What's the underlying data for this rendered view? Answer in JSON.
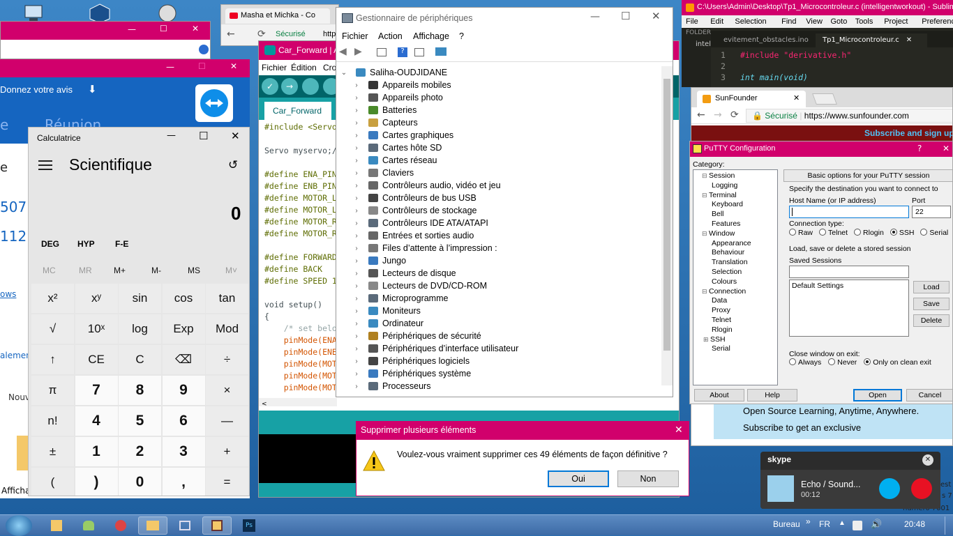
{
  "desktop": {
    "icons": [
      "computer-icon",
      "virtualbox-icon",
      "app-icon"
    ]
  },
  "back_window1": {
    "controls": [
      "—",
      "☐",
      "✕"
    ]
  },
  "back_window2": {
    "controls": [
      "—",
      "☐",
      "✕"
    ],
    "avis": "Donnez votre avis",
    "reunion": "Réunion",
    "n1": "507",
    "n2": "112",
    "link": "ows",
    "lem": "alement",
    "nouv": "Nouv",
    "affich": "Affichag",
    "e": "e"
  },
  "chrome_back": {
    "tab_title": "Masha et Michka - Co",
    "secure": "Sécurisé",
    "url_stub": "http"
  },
  "arduino": {
    "title": "Car_Forward | A",
    "menu": [
      "Fichier",
      "Édition",
      "Cro"
    ],
    "tab": "Car_Forward",
    "lines": [
      {
        "a": "#include <Servo"
      },
      {
        "a": ""
      },
      {
        "a": "Servo myservo;/"
      },
      {
        "a": ""
      },
      {
        "a": "#define ENA_PIN"
      },
      {
        "a": "#define ENB_PIN"
      },
      {
        "a": "#define MOTOR_L"
      },
      {
        "a": "#define MOTOR_L"
      },
      {
        "a": "#define MOTOR_R"
      },
      {
        "a": "#define MOTOR_R"
      },
      {
        "a": ""
      },
      {
        "a": "#define FORWARD"
      },
      {
        "a": "#define BACK"
      },
      {
        "a": "#define SPEED 1"
      },
      {
        "a": ""
      },
      {
        "a": "void setup()"
      },
      {
        "a": "{"
      },
      {
        "a": "    /* set belo"
      },
      {
        "a": "    pinMode(ENA"
      },
      {
        "a": "    pinMode(ENE"
      },
      {
        "a": "    pinMode(MOT"
      },
      {
        "a": "    pinMode(MOT"
      },
      {
        "a": "    pinMode(MOT"
      }
    ]
  },
  "calculator": {
    "title": "Calculatrice",
    "mode": "Scientifique",
    "display": "0",
    "angle": [
      "DEG",
      "HYP",
      "F-E"
    ],
    "memory": [
      "MC",
      "MR",
      "M+",
      "M-",
      "MS",
      "M˅"
    ],
    "keys": [
      [
        "x²",
        "xʸ",
        "sin",
        "cos",
        "tan"
      ],
      [
        "√",
        "10ˣ",
        "log",
        "Exp",
        "Mod"
      ],
      [
        "↑",
        "CE",
        "C",
        "⌫",
        "÷"
      ],
      [
        "π",
        "7",
        "8",
        "9",
        "×"
      ],
      [
        "n!",
        "4",
        "5",
        "6",
        "—"
      ],
      [
        "±",
        "1",
        "2",
        "3",
        "+"
      ],
      [
        "(",
        ")",
        "0",
        ",",
        "="
      ]
    ]
  },
  "devmgr": {
    "title": "Gestionnaire de périphériques",
    "menu": [
      "Fichier",
      "Action",
      "Affichage",
      "?"
    ],
    "root": "Saliha-OUDJIDANE",
    "items": [
      {
        "label": "Appareils mobiles",
        "color": "#333"
      },
      {
        "label": "Appareils photo",
        "color": "#555"
      },
      {
        "label": "Batteries",
        "color": "#4a8a2a"
      },
      {
        "label": "Capteurs",
        "color": "#c8a040"
      },
      {
        "label": "Cartes graphiques",
        "color": "#3a7abf"
      },
      {
        "label": "Cartes hôte SD",
        "color": "#5a6a7a"
      },
      {
        "label": "Cartes réseau",
        "color": "#3a8ac0"
      },
      {
        "label": "Claviers",
        "color": "#777"
      },
      {
        "label": "Contrôleurs audio, vidéo et jeu",
        "color": "#666"
      },
      {
        "label": "Contrôleurs de bus USB",
        "color": "#444"
      },
      {
        "label": "Contrôleurs de stockage",
        "color": "#888"
      },
      {
        "label": "Contrôleurs IDE ATA/ATAPI",
        "color": "#5a6a7a"
      },
      {
        "label": "Entrées et sorties audio",
        "color": "#666"
      },
      {
        "label": "Files d’attente à l’impression :",
        "color": "#777"
      },
      {
        "label": "Jungo",
        "color": "#3a7abf"
      },
      {
        "label": "Lecteurs de disque",
        "color": "#555"
      },
      {
        "label": "Lecteurs de DVD/CD-ROM",
        "color": "#888"
      },
      {
        "label": "Microprogramme",
        "color": "#5a6a7a"
      },
      {
        "label": "Moniteurs",
        "color": "#3a8ac0"
      },
      {
        "label": "Ordinateur",
        "color": "#3a8ac0"
      },
      {
        "label": "Périphériques de sécurité",
        "color": "#b08020"
      },
      {
        "label": "Périphériques d’interface utilisateur",
        "color": "#555"
      },
      {
        "label": "Périphériques logiciels",
        "color": "#444"
      },
      {
        "label": "Périphériques système",
        "color": "#3a7abf"
      },
      {
        "label": "Processeurs",
        "color": "#5a6a7a"
      }
    ]
  },
  "sublime": {
    "title": "C:\\Users\\Admin\\Desktop\\Tp1_Microcontroleur.c (intelligentworkout) - Sublime Tex",
    "menu": [
      "File",
      "Edit",
      "Selection",
      "Find",
      "View",
      "Goto",
      "Tools",
      "Project",
      "Preferences",
      "Help"
    ],
    "folders": "FOLDER",
    "folder_item": "intel",
    "tabs": [
      "evitement_obstacles.ino",
      "Tp1_Microcontroleur.c"
    ],
    "lines": [
      {
        "n": "1",
        "t": "#include \"derivative.h\""
      },
      {
        "n": "2",
        "t": ""
      },
      {
        "n": "3",
        "t": "int main(void)"
      }
    ]
  },
  "chrome_front": {
    "tab": "SunFounder",
    "secure": "Sécurisé",
    "url": "https://www.sunfounder.com",
    "banner": "Subscribe and sign up",
    "ad1": "Open Source Learning, Anytime, Anywhere.",
    "ad2": "Subscribe to get an exclusive"
  },
  "putty": {
    "title": "PuTTY Configuration",
    "category": "Category:",
    "tree": [
      {
        "label": "Session",
        "lvl": 0
      },
      {
        "label": "Logging",
        "lvl": 1
      },
      {
        "label": "Terminal",
        "lvl": 0
      },
      {
        "label": "Keyboard",
        "lvl": 1
      },
      {
        "label": "Bell",
        "lvl": 1
      },
      {
        "label": "Features",
        "lvl": 1
      },
      {
        "label": "Window",
        "lvl": 0
      },
      {
        "label": "Appearance",
        "lvl": 1
      },
      {
        "label": "Behaviour",
        "lvl": 1
      },
      {
        "label": "Translation",
        "lvl": 1
      },
      {
        "label": "Selection",
        "lvl": 1
      },
      {
        "label": "Colours",
        "lvl": 1
      },
      {
        "label": "Connection",
        "lvl": 0
      },
      {
        "label": "Data",
        "lvl": 1
      },
      {
        "label": "Proxy",
        "lvl": 1
      },
      {
        "label": "Telnet",
        "lvl": 1
      },
      {
        "label": "Rlogin",
        "lvl": 1
      },
      {
        "label": "SSH",
        "lvl": 1
      },
      {
        "label": "Serial",
        "lvl": 1
      }
    ],
    "basic": "Basic options for your PuTTY session",
    "dest": "Specify the destination you want to connect to",
    "host_label": "Host Name (or IP address)",
    "port_label": "Port",
    "port": "22",
    "conn_type": "Connection type:",
    "types": [
      "Raw",
      "Telnet",
      "Rlogin",
      "SSH",
      "Serial"
    ],
    "sessions_hdr": "Load, save or delete a stored session",
    "saved": "Saved Sessions",
    "default": "Default Settings",
    "load": "Load",
    "save": "Save",
    "delete": "Delete",
    "close_hdr": "Close window on exit:",
    "close_opts": [
      "Always",
      "Never",
      "Only on clean exit"
    ],
    "about": "About",
    "help": "Help",
    "open": "Open",
    "cancel": "Cancel",
    "qmark": "?",
    "x": "✕"
  },
  "dialog": {
    "title": "Supprimer plusieurs éléments",
    "message": "Voulez-vous vraiment supprimer ces 49 éléments de façon définitive ?",
    "yes": "Oui",
    "no": "Non"
  },
  "skype": {
    "brand": "skype",
    "name": "Echo / Sound...",
    "time": "00:12"
  },
  "right_edge": {
    "l1": "est",
    "l2": "s 7",
    "l3": "numéro 7001"
  },
  "taskbar": {
    "bureau": "Bureau",
    "lang": "FR",
    "clock": "20:48"
  },
  "colors": {
    "accent": "#d1006c",
    "arduino": "#00979c",
    "sublime_bg": "#272822",
    "putty_title": "#d1006c"
  }
}
